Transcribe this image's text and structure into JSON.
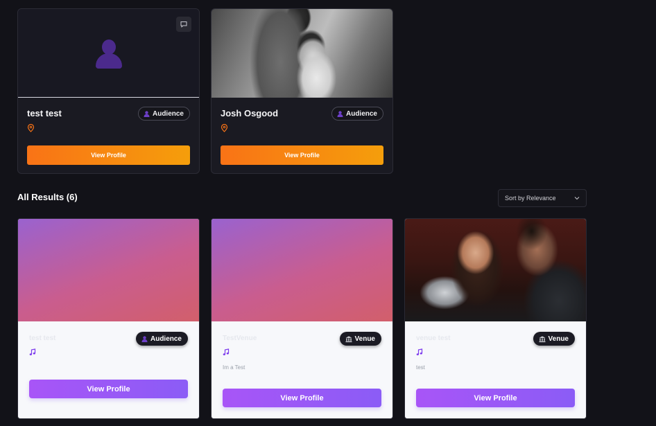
{
  "featured": [
    {
      "name": "test test",
      "badge": "Audience",
      "button": "View Profile",
      "image": "avatar-placeholder"
    },
    {
      "name": "Josh Osgood",
      "badge": "Audience",
      "button": "View Profile",
      "image": "wedding-photo"
    }
  ],
  "results": {
    "title": "All Results (6)",
    "sort": {
      "selected": "Sort by Relevance"
    },
    "cards": [
      {
        "name": "test test",
        "badge": "Audience",
        "badge_icon": "person-icon",
        "description": "",
        "button": "View Profile"
      },
      {
        "name": "TestVenue",
        "badge": "Venue",
        "badge_icon": "building-icon",
        "description": "Im a Test",
        "button": "View Profile"
      },
      {
        "name": "venue test",
        "badge": "Venue",
        "badge_icon": "building-icon",
        "description": "test",
        "button": "View Profile"
      }
    ]
  },
  "colors": {
    "background": "#121218",
    "accent_orange": "#f97316",
    "accent_purple": "#a855f7"
  }
}
